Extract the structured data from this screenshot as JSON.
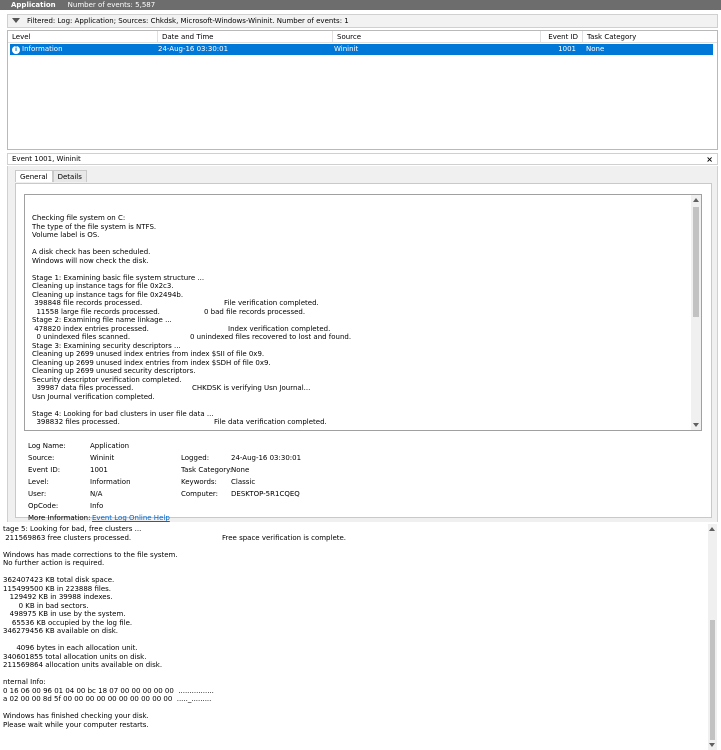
{
  "titlebar": {
    "name": "Application",
    "count": "Number of events: 5,587"
  },
  "filter": {
    "text": "Filtered: Log: Application; Sources: Chkdsk, Microsoft-Windows-Wininit. Number of events: 1"
  },
  "grid": {
    "headers": {
      "level": "Level",
      "datetime": "Date and Time",
      "source": "Source",
      "event_id": "Event ID",
      "task_category": "Task Category"
    },
    "row": {
      "level": "Information",
      "datetime": "24-Aug-16 03:30:01",
      "source": "Wininit",
      "event_id": "1001",
      "task_category": "None"
    }
  },
  "detail": {
    "header": "Event 1001, Wininit",
    "close_label": "×",
    "tabs": {
      "general": "General",
      "details": "Details"
    }
  },
  "description_lines": [
    {
      "left": "Checking file system on C:",
      "right": ""
    },
    {
      "left": "The type of the file system is NTFS.",
      "right": ""
    },
    {
      "left": "Volume label is OS.",
      "right": ""
    },
    {
      "left": "",
      "right": ""
    },
    {
      "left": "A disk check has been scheduled.",
      "right": ""
    },
    {
      "left": "Windows will now check the disk.",
      "right": ""
    },
    {
      "left": "",
      "right": ""
    },
    {
      "left": "Stage 1: Examining basic file system structure ...",
      "right": ""
    },
    {
      "left": "Cleaning up instance tags for file 0x2c3.",
      "right": ""
    },
    {
      "left": "Cleaning up instance tags for file 0x2494b.",
      "right": ""
    },
    {
      "left": " 398848 file records processed.",
      "right": "File verification completed."
    },
    {
      "left": "  11558 large file records processed.",
      "right": "0 bad file records processed."
    },
    {
      "left": "Stage 2: Examining file name linkage ...",
      "right": ""
    },
    {
      "left": " 478820 index entries processed.",
      "right": "Index verification completed."
    },
    {
      "left": "  0 unindexed files scanned.",
      "right": "0 unindexed files recovered to lost and found."
    },
    {
      "left": "Stage 3: Examining security descriptors ...",
      "right": ""
    },
    {
      "left": "Cleaning up 2699 unused index entries from index $SII of file 0x9.",
      "right": ""
    },
    {
      "left": "Cleaning up 2699 unused index entries from index $SDH of file 0x9.",
      "right": ""
    },
    {
      "left": "Cleaning up 2699 unused security descriptors.",
      "right": ""
    },
    {
      "left": "Security descriptor verification completed.",
      "right": ""
    },
    {
      "left": "  39987 data files processed.",
      "right": "CHKDSK is verifying Usn Journal..."
    },
    {
      "left": "Usn Journal verification completed.",
      "right": ""
    },
    {
      "left": "",
      "right": ""
    },
    {
      "left": "Stage 4: Looking for bad clusters in user file data ...",
      "right": ""
    },
    {
      "left": "  398832 files processed.",
      "right": "File data verification completed."
    }
  ],
  "properties": {
    "log_name_label": "Log Name:",
    "log_name": "Application",
    "source_label": "Source:",
    "source": "Wininit",
    "logged_label": "Logged:",
    "logged": "24-Aug-16 03:30:01",
    "event_id_label": "Event ID:",
    "event_id": "1001",
    "task_category_label": "Task Category:",
    "task_category": "None",
    "level_label": "Level:",
    "level": "Information",
    "keywords_label": "Keywords:",
    "keywords": "Classic",
    "user_label": "User:",
    "user": "N/A",
    "computer_label": "Computer:",
    "computer": "DESKTOP-5R1CQEQ",
    "opcode_label": "OpCode:",
    "opcode": "Info",
    "more_info_label": "More Information:",
    "more_info_link": "Event Log Online Help"
  },
  "bottom_lines": [
    {
      "left": "tage 5: Looking for bad, free clusters ...",
      "right": ""
    },
    {
      "left": " 211569863 free clusters processed.",
      "right": "Free space verification is complete."
    },
    {
      "left": "",
      "right": ""
    },
    {
      "left": "Windows has made corrections to the file system.",
      "right": ""
    },
    {
      "left": "No further action is required.",
      "right": ""
    },
    {
      "left": "",
      "right": ""
    },
    {
      "left": "362407423 KB total disk space.",
      "right": ""
    },
    {
      "left": "115499500 KB in 223888 files.",
      "right": ""
    },
    {
      "left": "   129492 KB in 39988 indexes.",
      "right": ""
    },
    {
      "left": "       0 KB in bad sectors.",
      "right": ""
    },
    {
      "left": "   498975 KB in use by the system.",
      "right": ""
    },
    {
      "left": "    65536 KB occupied by the log file.",
      "right": ""
    },
    {
      "left": "346279456 KB available on disk.",
      "right": ""
    },
    {
      "left": "",
      "right": ""
    },
    {
      "left": "      4096 bytes in each allocation unit.",
      "right": ""
    },
    {
      "left": "340601855 total allocation units on disk.",
      "right": ""
    },
    {
      "left": "211569864 allocation units available on disk.",
      "right": ""
    },
    {
      "left": "",
      "right": ""
    },
    {
      "left": "nternal Info:",
      "right": ""
    },
    {
      "left": "0 16 06 00 96 01 04 00 bc 18 07 00 00 00 00 00  ................",
      "right": ""
    },
    {
      "left": "a 02 00 00 8d 5f 00 00 00 00 00 00 00 00 00 00  ....._.........",
      "right": ""
    },
    {
      "left": "",
      "right": ""
    },
    {
      "left": "Windows has finished checking your disk.",
      "right": ""
    },
    {
      "left": "Please wait while your computer restarts.",
      "right": ""
    }
  ]
}
